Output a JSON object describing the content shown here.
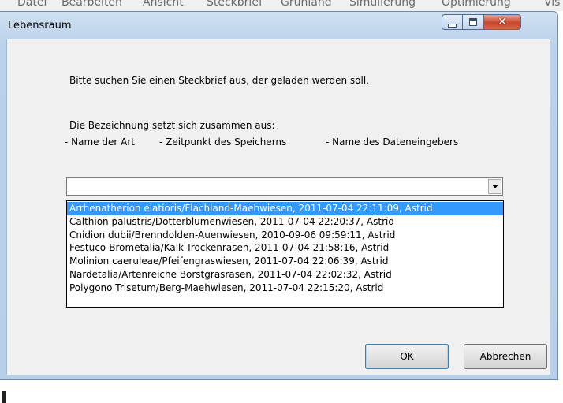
{
  "background_app": {
    "menu": [
      "Datei",
      "Bearbeiten",
      "Ansicht",
      "Steckbrief",
      "Grünland",
      "Simulierung",
      "Optimierung",
      "Vis"
    ]
  },
  "dialog": {
    "title": "Lebensraum",
    "prompt": "Bitte suchen Sie einen Steckbrief aus, der geladen werden soll.",
    "description": "Die Bezeichnung setzt sich zusammen aus:",
    "parts": [
      "- Name der Art",
      "- Zeitpunkt des Speicherns",
      "- Name des Dateneingebers"
    ],
    "combo_value": "",
    "options": [
      "Arrhenatherion elatioris/Flachland-Maehwiesen, 2011-07-04 22:11:09, Astrid",
      "Calthion palustris/Dotterblumenwiesen, 2011-07-04 22:20:37, Astrid",
      "Cnidion dubii/Brenndolden-Auenwiesen, 2010-09-06 09:59:11, Astrid",
      "Festuco-Brometalia/Kalk-Trockenrasen, 2011-07-04 21:58:16, Astrid",
      "Molinion caeruleae/Pfeifengraswiesen, 2011-07-04 22:06:39, Astrid",
      "Nardetalia/Artenreiche Borstgrasrasen, 2011-07-04 22:02:32, Astrid",
      "Polygono Trisetum/Berg-Maehwiesen, 2011-07-04 22:15:20, Astrid"
    ],
    "selected_option": "Arrhenatherion elatioris/Flachland-Maehwiesen, 2011-07-04 22:11:09, Astrid",
    "ok_label": "OK",
    "cancel_label": "Abbrechen",
    "selection_color": "#3399ff"
  }
}
